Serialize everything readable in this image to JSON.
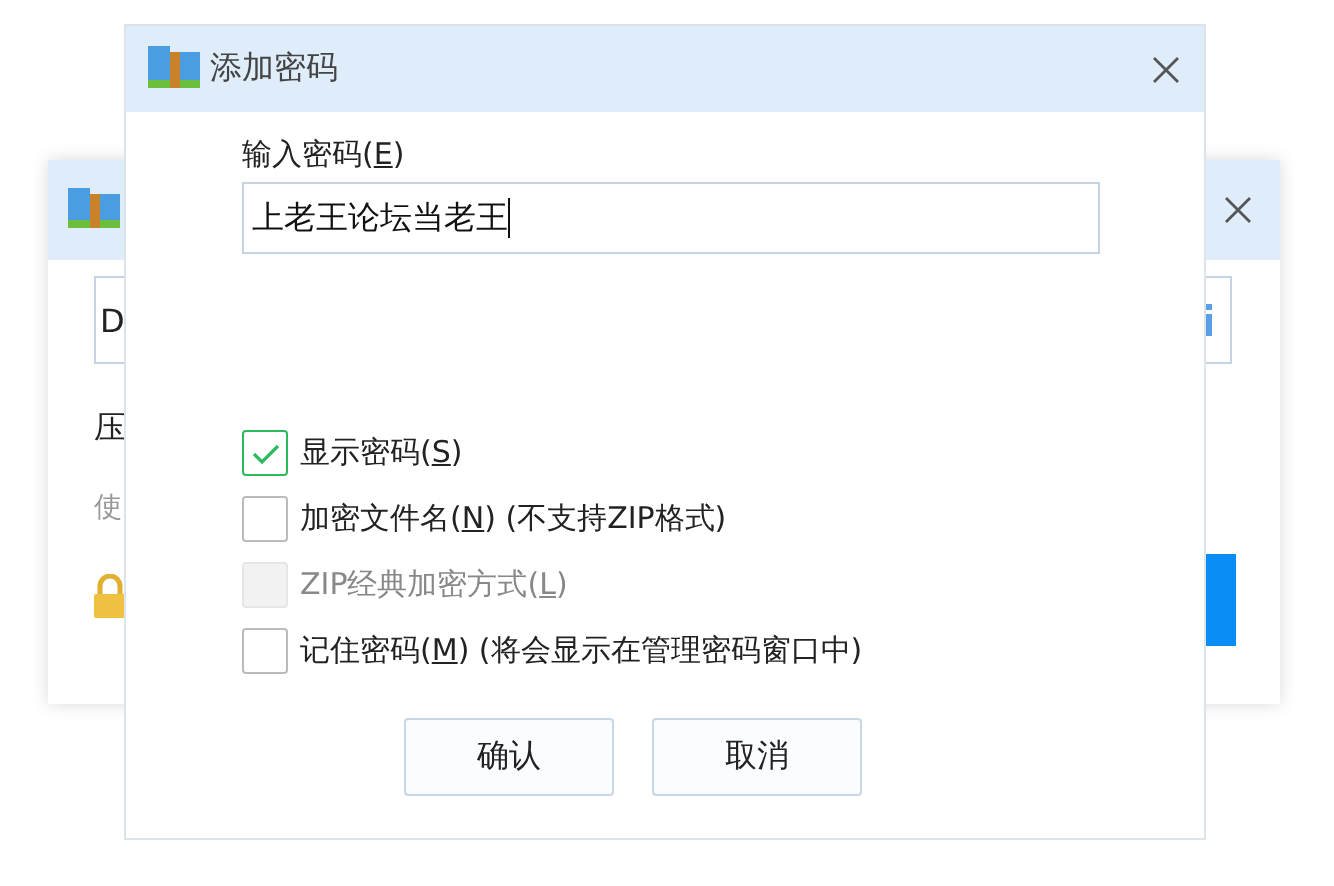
{
  "background_window": {
    "field_value": "D",
    "label": "压",
    "hint": "使"
  },
  "dialog": {
    "title": "添加密码",
    "password_label": {
      "text": "输入密码(",
      "key": "E",
      "tail": ")"
    },
    "password_value": "上老王论坛当老王",
    "options": [
      {
        "text": "显示密码(",
        "key": "S",
        "tail": ")",
        "checked": true,
        "disabled": false
      },
      {
        "text": "加密文件名(",
        "key": "N",
        "tail": ") (不支持ZIP格式)",
        "checked": false,
        "disabled": false
      },
      {
        "text": "ZIP经典加密方式(",
        "key": "L",
        "tail": ")",
        "checked": false,
        "disabled": true
      },
      {
        "text": "记住密码(",
        "key": "M",
        "tail": ") (将会显示在管理密码窗口中)",
        "checked": false,
        "disabled": false
      }
    ],
    "buttons": [
      "确认",
      "取消"
    ]
  }
}
